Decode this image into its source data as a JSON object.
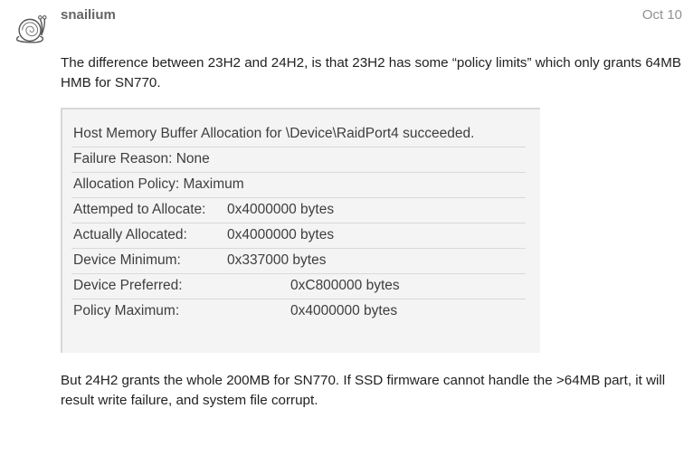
{
  "post": {
    "username": "snailium",
    "date": "Oct 10",
    "body1": "The difference between 23H2 and 24H2, is that 23H2 has some “policy limits” which only grants 64MB HMB for SN770.",
    "body2": "But 24H2 grants the whole 200MB for SN770. If SSD firmware cannot handle the >64MB part, it will result write failure, and system file corrupt."
  },
  "embed": {
    "line1": "Host Memory Buffer Allocation for \\Device\\RaidPort4 succeeded.",
    "line2": "Failure Reason: None",
    "line3": "Allocation Policy: Maximum",
    "rows": [
      {
        "label": "Attemped to Allocate:",
        "value": "0x4000000 bytes"
      },
      {
        "label": "Actually Allocated:",
        "value": "0x4000000 bytes"
      },
      {
        "label": "Device Minimum:",
        "value": "0x337000 bytes"
      }
    ],
    "rows2": [
      {
        "label": "Device Preferred:",
        "value": "0xC800000 bytes"
      },
      {
        "label": "Policy Maximum:",
        "value": "0x4000000 bytes"
      }
    ]
  }
}
